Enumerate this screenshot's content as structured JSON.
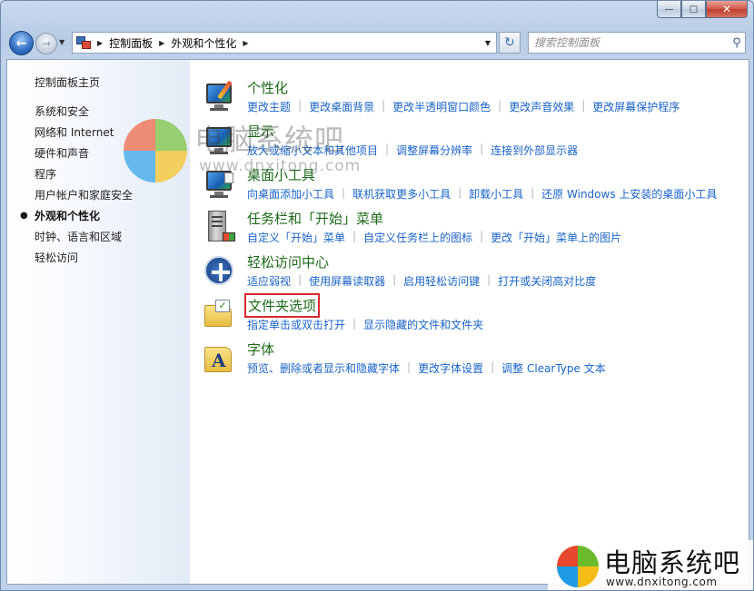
{
  "window": {
    "minimize": "—",
    "maximize": "□",
    "close": "✕"
  },
  "nav": {
    "back": "←",
    "forward": "→",
    "history": "▼",
    "breadcrumbs": [
      "控制面板",
      "外观和个性化"
    ],
    "sep": "▶",
    "dropdown": "▼",
    "refresh": "↻",
    "search_placeholder": "搜索控制面板",
    "search_glyph": "⚲"
  },
  "sidebar": {
    "bullet": "●",
    "items": [
      {
        "label": "控制面板主页"
      },
      {
        "label": "系统和安全"
      },
      {
        "label": "网络和 Internet"
      },
      {
        "label": "硬件和声音"
      },
      {
        "label": "程序"
      },
      {
        "label": "用户帐户和家庭安全"
      },
      {
        "label": "外观和个性化",
        "active": true
      },
      {
        "label": "时钟、语言和区域"
      },
      {
        "label": "轻松访问"
      }
    ]
  },
  "categories": [
    {
      "title": "个性化",
      "icon": "personalization-icon",
      "links": [
        "更改主题",
        "更改桌面背景",
        "更改半透明窗口颜色",
        "更改声音效果",
        "更改屏幕保护程序"
      ]
    },
    {
      "title": "显示",
      "icon": "display-icon",
      "links": [
        "放大或缩小文本和其他项目",
        "调整屏幕分辨率",
        "连接到外部显示器"
      ]
    },
    {
      "title": "桌面小工具",
      "icon": "gadgets-icon",
      "links": [
        "向桌面添加小工具",
        "联机获取更多小工具",
        "卸载小工具",
        "还原 Windows 上安装的桌面小工具"
      ]
    },
    {
      "title": "任务栏和「开始」菜单",
      "icon": "taskbar-icon",
      "links": [
        "自定义「开始」菜单",
        "自定义任务栏上的图标",
        "更改「开始」菜单上的图片"
      ]
    },
    {
      "title": "轻松访问中心",
      "icon": "ease-of-access-icon",
      "links": [
        "适应弱视",
        "使用屏幕读取器",
        "启用轻松访问键",
        "打开或关闭高对比度"
      ]
    },
    {
      "title": "文件夹选项",
      "icon": "folder-options-icon",
      "highlight": true,
      "links": [
        "指定单击或双击打开",
        "显示隐藏的文件和文件夹"
      ]
    },
    {
      "title": "字体",
      "icon": "fonts-icon",
      "links": [
        "预览、删除或者显示和隐藏字体",
        "更改字体设置",
        "调整 ClearType 文本"
      ]
    }
  ],
  "watermark": {
    "title": "电脑系统吧",
    "url": "www.dnxitong.com"
  },
  "logo": {
    "title": "电脑系统吧",
    "url": "www.dnxitong.com"
  },
  "colors": {
    "category_title": "#1e6a1a",
    "link": "#1a63c7",
    "highlight_box": "#d8282d"
  }
}
